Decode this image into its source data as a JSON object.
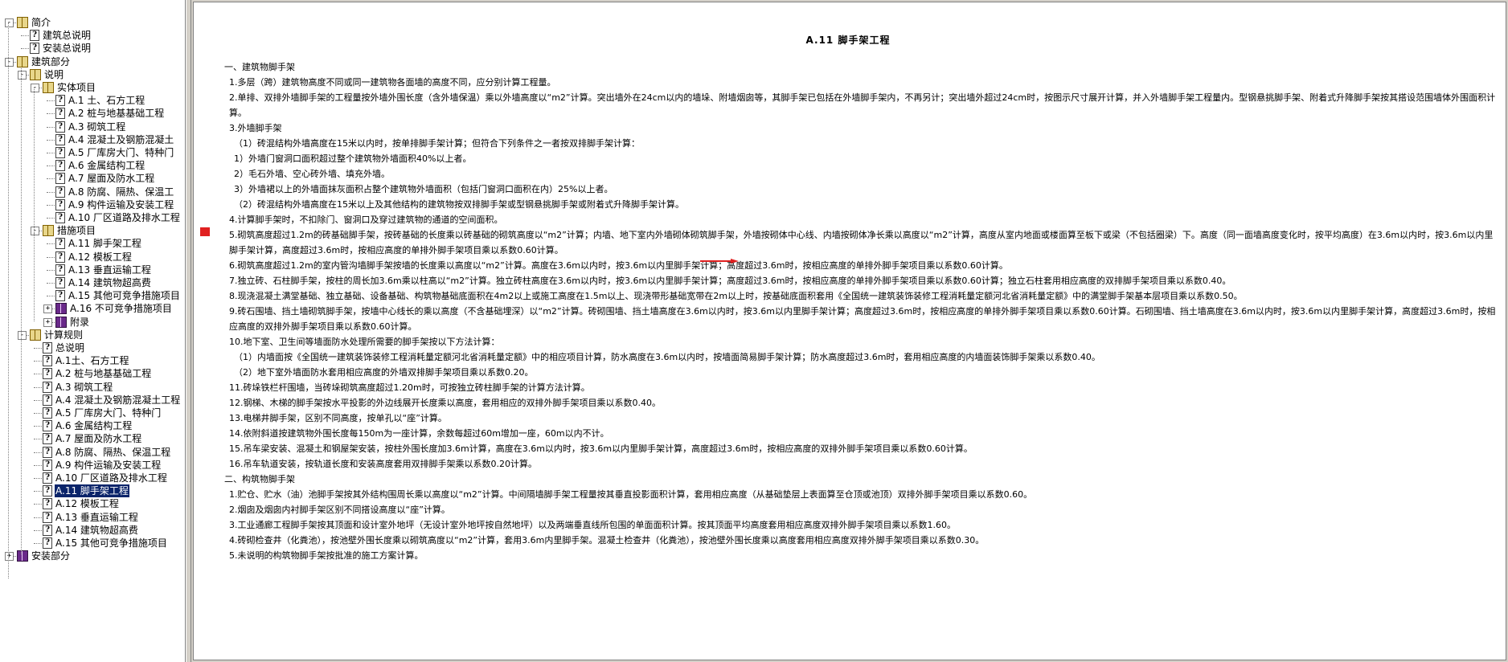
{
  "tree": [
    {
      "label": "简介",
      "level": 0,
      "icon": "book-icon",
      "expander": "-"
    },
    {
      "label": "建筑总说明",
      "level": 1,
      "icon": "help-topic-icon"
    },
    {
      "label": "安装总说明",
      "level": 1,
      "icon": "help-topic-icon"
    },
    {
      "label": "建筑部分",
      "level": 0,
      "icon": "book-icon",
      "expander": "-"
    },
    {
      "label": "说明",
      "level": 1,
      "icon": "book-icon",
      "expander": "-"
    },
    {
      "label": "实体项目",
      "level": 2,
      "icon": "book-icon",
      "expander": "-"
    },
    {
      "label": "A.1 土、石方工程",
      "level": 3,
      "icon": "help-topic-icon"
    },
    {
      "label": "A.2 桩与地基基础工程",
      "level": 3,
      "icon": "help-topic-icon"
    },
    {
      "label": "A.3 砌筑工程",
      "level": 3,
      "icon": "help-topic-icon"
    },
    {
      "label": "A.4 混凝土及钢筋混凝土",
      "level": 3,
      "icon": "help-topic-icon"
    },
    {
      "label": "A.5 厂库房大门、特种门",
      "level": 3,
      "icon": "help-topic-icon"
    },
    {
      "label": "A.6 金属结构工程",
      "level": 3,
      "icon": "help-topic-icon"
    },
    {
      "label": "A.7 屋面及防水工程",
      "level": 3,
      "icon": "help-topic-icon"
    },
    {
      "label": "A.8 防腐、隔热、保温工",
      "level": 3,
      "icon": "help-topic-icon"
    },
    {
      "label": "A.9 构件运输及安装工程",
      "level": 3,
      "icon": "help-topic-icon"
    },
    {
      "label": "A.10 厂区道路及排水工程",
      "level": 3,
      "icon": "help-topic-icon"
    },
    {
      "label": "措施项目",
      "level": 2,
      "icon": "book-icon",
      "expander": "-"
    },
    {
      "label": "A.11 脚手架工程",
      "level": 3,
      "icon": "help-topic-icon"
    },
    {
      "label": "A.12 模板工程",
      "level": 3,
      "icon": "help-topic-icon"
    },
    {
      "label": "A.13 垂直运输工程",
      "level": 3,
      "icon": "help-topic-icon"
    },
    {
      "label": "A.14 建筑物超高费",
      "level": 3,
      "icon": "help-topic-icon"
    },
    {
      "label": "A.15 其他可竞争措施项目",
      "level": 3,
      "icon": "help-topic-icon"
    },
    {
      "label": "A.16 不可竞争措施项目",
      "level": 3,
      "icon": "closed-book-icon",
      "expander": "+"
    },
    {
      "label": "附录",
      "level": 3,
      "icon": "closed-book-icon",
      "expander": "+"
    },
    {
      "label": "计算规则",
      "level": 1,
      "icon": "book-icon",
      "expander": "-"
    },
    {
      "label": "总说明",
      "level": 2,
      "icon": "help-topic-icon"
    },
    {
      "label": "A.1土、石方工程",
      "level": 2,
      "icon": "help-topic-icon"
    },
    {
      "label": "A.2 桩与地基基础工程",
      "level": 2,
      "icon": "help-topic-icon"
    },
    {
      "label": "A.3 砌筑工程",
      "level": 2,
      "icon": "help-topic-icon"
    },
    {
      "label": "A.4 混凝土及钢筋混凝土工程",
      "level": 2,
      "icon": "help-topic-icon"
    },
    {
      "label": "A.5 厂库房大门、特种门",
      "level": 2,
      "icon": "help-topic-icon"
    },
    {
      "label": "A.6 金属结构工程",
      "level": 2,
      "icon": "help-topic-icon"
    },
    {
      "label": "A.7 屋面及防水工程",
      "level": 2,
      "icon": "help-topic-icon"
    },
    {
      "label": "A.8 防腐、隔热、保温工程",
      "level": 2,
      "icon": "help-topic-icon"
    },
    {
      "label": "A.9 构件运输及安装工程",
      "level": 2,
      "icon": "help-topic-icon"
    },
    {
      "label": "A.10 厂区道路及排水工程",
      "level": 2,
      "icon": "help-topic-icon"
    },
    {
      "label": "A.11 脚手架工程",
      "level": 2,
      "icon": "help-topic-icon",
      "selected": true
    },
    {
      "label": "A.12 模板工程",
      "level": 2,
      "icon": "help-topic-icon"
    },
    {
      "label": "A.13 垂直运输工程",
      "level": 2,
      "icon": "help-topic-icon"
    },
    {
      "label": "A.14 建筑物超高费",
      "level": 2,
      "icon": "help-topic-icon"
    },
    {
      "label": "A.15 其他可竞争措施项目",
      "level": 2,
      "icon": "help-topic-icon"
    },
    {
      "label": "安装部分",
      "level": 0,
      "icon": "closed-book-icon",
      "expander": "+"
    }
  ],
  "doc": {
    "title": "A.11 脚手架工程",
    "paragraphs": [
      {
        "indent": "i1",
        "text": "一、建筑物脚手架"
      },
      {
        "indent": "i2",
        "text": "1.多层（跨）建筑物高度不同或同一建筑物各面墙的高度不同，应分别计算工程量。"
      },
      {
        "indent": "i2",
        "text": "2.单排、双排外墙脚手架的工程量按外墙外围长度（含外墙保温）乘以外墙高度以“m2”计算。突出墙外在24cm以内的墙垛、附墙烟囱等，其脚手架已包括在外墙脚手架内，不再另计；突出墙外超过24cm时，按图示尺寸展开计算，并入外墙脚手架工程量内。型钢悬挑脚手架、附着式升降脚手架按其搭设范围墙体外围面积计算。"
      },
      {
        "indent": "i2",
        "text": "3.外墙脚手架"
      },
      {
        "indent": "i3",
        "text": "（1）砖混结构外墙高度在15米以内时，按单排脚手架计算；但符合下列条件之一者按双排脚手架计算："
      },
      {
        "indent": "i3",
        "text": "1）外墙门窗洞口面积超过整个建筑物外墙面积40%以上者。"
      },
      {
        "indent": "i3",
        "text": "2）毛石外墙、空心砖外墙、填充外墙。"
      },
      {
        "indent": "i3",
        "text": "3）外墙裙以上的外墙面抹灰面积占整个建筑物外墙面积（包括门窗洞口面积在内）25%以上者。"
      },
      {
        "indent": "i3",
        "text": "（2）砖混结构外墙高度在15米以上及其他结构的建筑物按双排脚手架或型钢悬挑脚手架或附着式升降脚手架计算。"
      },
      {
        "indent": "i2",
        "text": "4.计算脚手架时，不扣除门、窗洞口及穿过建筑物的通道的空间面积。"
      },
      {
        "indent": "i2",
        "text": "5.砌筑高度超过1.2m的砖基础脚手架，按砖基础的长度乘以砖基础的砌筑高度以“m2”计算；内墙、地下室内外墙砌体砌筑脚手架，外墙按砌体中心线、内墙按砌体净长乘以高度以“m2”计算，高度从室内地面或楼面算至板下或梁（不包括圈梁）下。高度（同一面墙高度变化时，按平均高度）在3.6m以内时，按3.6m以内里脚手架计算，高度超过3.6m时，按相应高度的单排外脚手架项目乘以系数0.60计算。"
      },
      {
        "indent": "i2",
        "text": "6.砌筑高度超过1.2m的室内管沟墙脚手架按墙的长度乘以高度以“m2”计算。高度在3.6m以内时，按3.6m以内里脚手架计算；高度超过3.6m时，按相应高度的单排外脚手架项目乘以系数0.60计算。"
      },
      {
        "indent": "i2",
        "text": "7.独立砖、石柱脚手架，按柱的周长加3.6m乘以柱高以“m2”计算。独立砖柱高度在3.6m以内时，按3.6m以内里脚手架计算；高度超过3.6m时，按相应高度的单排外脚手架项目乘以系数0.60计算；独立石柱套用相应高度的双排脚手架项目乘以系数0.40。"
      },
      {
        "indent": "i2",
        "text": "8.现浇混凝土满堂基础、独立基础、设备基础、构筑物基础底面积在4m2以上或施工高度在1.5m以上、现浇带形基础宽带在2m以上时，按基础底面积套用《全国统一建筑装饰装修工程消耗量定额河北省消耗量定额》中的满堂脚手架基本层项目乘以系数0.50。"
      },
      {
        "indent": "i2",
        "text": "9.砖石围墙、挡土墙砌筑脚手架，按墙中心线长的乘以高度（不含基础埋深）以“m2”计算。砖砌围墙、挡土墙高度在3.6m以内时，按3.6m以内里脚手架计算；高度超过3.6m时，按相应高度的单排外脚手架项目乘以系数0.60计算。石砌围墙、挡土墙高度在3.6m以内时，按3.6m以内里脚手架计算，高度超过3.6m时，按相应高度的双排外脚手架项目乘以系数0.60计算。"
      },
      {
        "indent": "i2",
        "text": "10.地下室、卫生间等墙面防水处理所需要的脚手架按以下方法计算："
      },
      {
        "indent": "i3",
        "text": "（1）内墙面按《全国统一建筑装饰装修工程消耗量定额河北省消耗量定额》中的相应项目计算，防水高度在3.6m以内时，按墙面简易脚手架计算；防水高度超过3.6m时，套用相应高度的内墙面装饰脚手架乘以系数0.40。"
      },
      {
        "indent": "i3",
        "text": "（2）地下室外墙面防水套用相应高度的外墙双排脚手架项目乘以系数0.20。"
      },
      {
        "indent": "i2",
        "text": "11.砖垛铁栏杆围墙，当砖垛砌筑高度超过1.20m时，可按独立砖柱脚手架的计算方法计算。"
      },
      {
        "indent": "i2",
        "text": "12.钢梯、木梯的脚手架按水平投影的外边线展开长度乘以高度，套用相应的双排外脚手架项目乘以系数0.40。"
      },
      {
        "indent": "i2",
        "text": "13.电梯井脚手架，区别不同高度，按单孔以“座”计算。"
      },
      {
        "indent": "i2",
        "text": "14.依附斜道按建筑物外围长度每150m为一座计算，余数每超过60m增加一座，60m以内不计。"
      },
      {
        "indent": "i2",
        "text": "15.吊车梁安装、混凝土和钢屋架安装，按柱外围长度加3.6m计算，高度在3.6m以内时，按3.6m以内里脚手架计算，高度超过3.6m时，按相应高度的双排外脚手架项目乘以系数0.60计算。"
      },
      {
        "indent": "i2",
        "text": "16.吊车轨道安装，按轨道长度和安装高度套用双排脚手架乘以系数0.20计算。"
      },
      {
        "indent": "i1",
        "text": "二、构筑物脚手架"
      },
      {
        "indent": "i2",
        "text": "1.贮仓、贮水（油）池脚手架按其外结构围周长乘以高度以“m2”计算。中间隔墙脚手架工程量按其垂直投影面积计算，套用相应高度（从基础垫层上表面算至仓顶或池顶）双排外脚手架项目乘以系数0.60。"
      },
      {
        "indent": "i2",
        "text": "2.烟囱及烟囱内衬脚手架区别不同搭设高度以“座”计算。"
      },
      {
        "indent": "i2",
        "text": "3.工业通廊工程脚手架按其顶面和设计室外地坪（无设计室外地坪按自然地坪）以及两端垂直线所包围的单面面积计算。按其顶面平均高度套用相应高度双排外脚手架项目乘以系数1.60。"
      },
      {
        "indent": "i2",
        "text": "4.砖砌检查井（化粪池），按池壁外围长度乘以砌筑高度以“m2”计算，套用3.6m内里脚手架。混凝土检查井（化粪池），按池壁外围长度乘以高度套用相应高度双排外脚手架项目乘以系数0.30。"
      },
      {
        "indent": "i2",
        "text": "5.未说明的构筑物脚手架按批准的施工方案计算。"
      }
    ]
  },
  "colors": {
    "selection": "#0a246a",
    "marker": "#e02020"
  }
}
